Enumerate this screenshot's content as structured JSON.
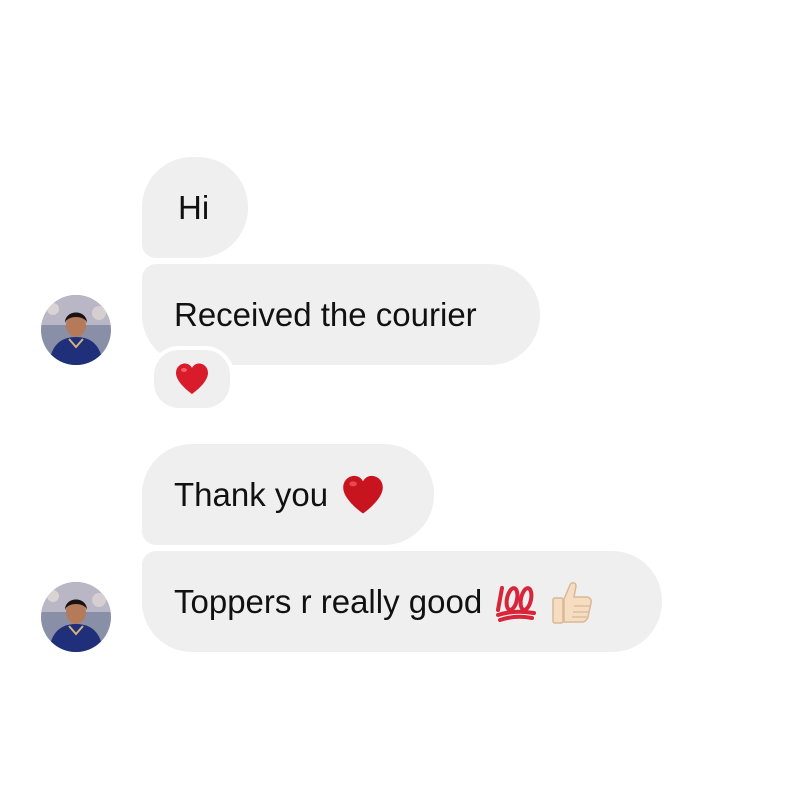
{
  "chat": {
    "messages": [
      {
        "text": "Hi",
        "emojis": []
      },
      {
        "text": "Received the courier",
        "reaction": "heart-icon"
      },
      {
        "text": "Thank you",
        "emojis": [
          "heart-icon"
        ]
      },
      {
        "text": "Toppers r really good",
        "emojis": [
          "hundred-points-icon",
          "thumbs-up-icon"
        ]
      }
    ]
  },
  "colors": {
    "bubble": "#efefef",
    "heart": "#d81c2b",
    "hundred": "#d8253a",
    "thumb": "#f6dcc1"
  }
}
